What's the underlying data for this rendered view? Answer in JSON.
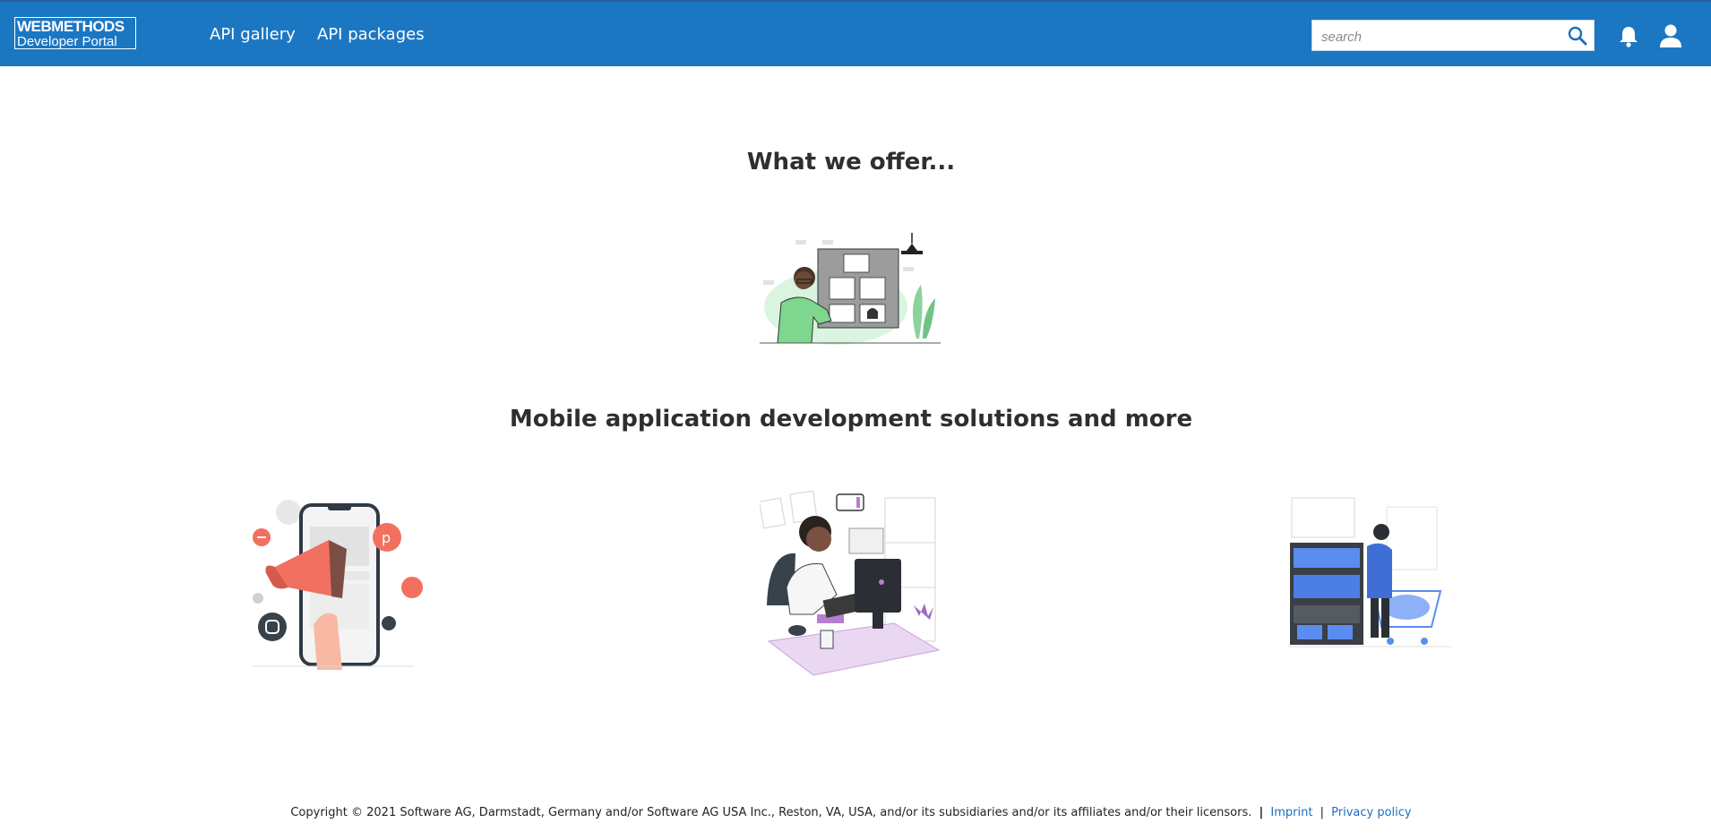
{
  "header": {
    "logo": {
      "line1": "WEBMETHODS",
      "line2": "Developer Portal"
    },
    "nav": [
      {
        "label": "API gallery"
      },
      {
        "label": "API packages"
      }
    ],
    "search": {
      "placeholder": "search",
      "value": ""
    },
    "icons": [
      "search-icon",
      "bell-icon",
      "user-icon"
    ],
    "colors": {
      "bar": "#1c77c3",
      "text": "#ffffff"
    }
  },
  "main": {
    "offer_heading": "What we offer...",
    "solutions_heading": "Mobile application development solutions and more"
  },
  "footer": {
    "copyright": "Copyright © 2021 Software AG, Darmstadt, Germany and/or Software AG USA Inc., Reston, VA, USA, and/or its subsidiaries and/or its affiliates and/or their licensors.",
    "separator": "|",
    "links": [
      {
        "label": "Imprint"
      },
      {
        "label": "Privacy policy"
      }
    ],
    "link_separator": "|",
    "link_color": "#1c6fc0"
  }
}
